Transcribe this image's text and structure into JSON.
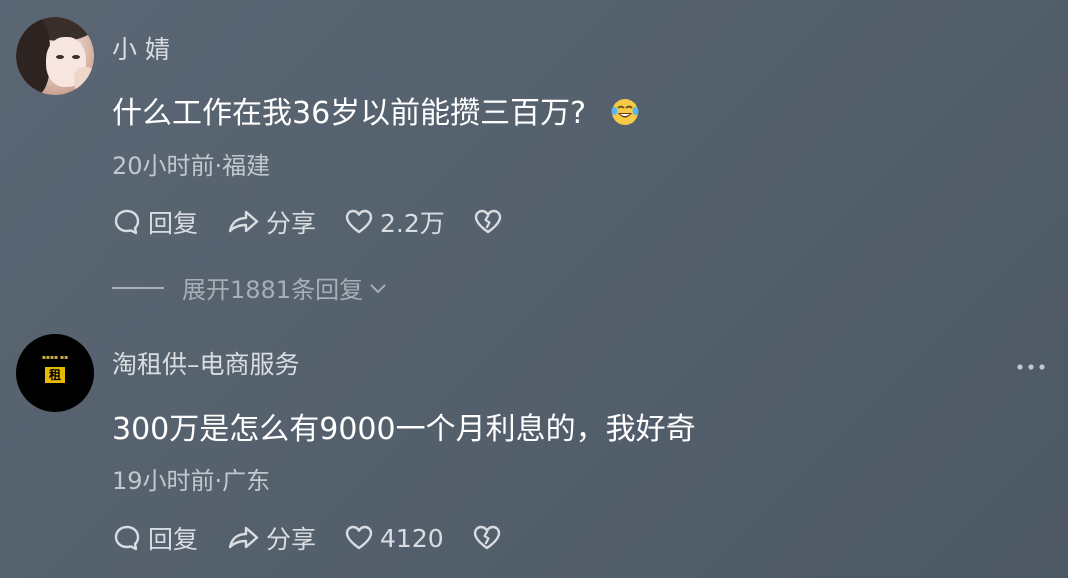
{
  "comments": [
    {
      "username": "小 婧",
      "content": "什么工作在我36岁以前能攒三百万?",
      "emoji": "laugh-cry-emoji",
      "meta": "20小时前·福建",
      "reply_label": "回复",
      "share_label": "分享",
      "likes": "2.2万",
      "expand_label": "展开1881条回复"
    },
    {
      "username": "淘租供–电商服务",
      "avatar_logo_text": "淘租",
      "content": "300万是怎么有9000一个月利息的，我好奇",
      "meta": "19小时前·广东",
      "reply_label": "回复",
      "share_label": "分享",
      "likes": "4120"
    }
  ],
  "colors": {
    "background": "#56616e",
    "text_primary": "#ffffff",
    "text_secondary": "#c3c8ce",
    "expand": "#a7aeb6"
  }
}
